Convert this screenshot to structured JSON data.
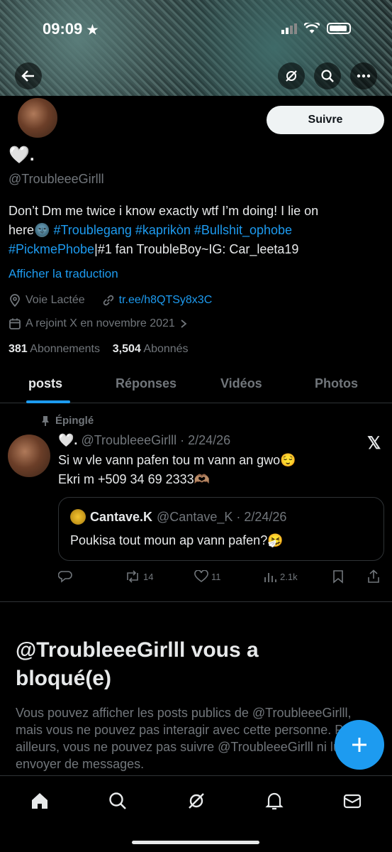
{
  "status_bar": {
    "time": "09:09"
  },
  "header": {
    "follow_label": "Suivre"
  },
  "profile": {
    "name": "🤍.",
    "handle": "@TroubleeeGirlll",
    "bio_line1": "Don’t Dm me twice i know exactly wtf I’m doing! I lie on",
    "bio_line2_text": "here🌚 ",
    "bio_hashtags_line2": "#Troublegang #kaprikòn #Bullshit_ophobe",
    "bio_hashtag_line3": "#PickmePhobe",
    "bio_line3_rest": "|#1 fan TroubleBoy~IG: Car_leeta19",
    "translate": "Afficher la traduction",
    "location": "Voie Lactée",
    "website": "tr.ee/h8QTSy8x3C",
    "joined": "A rejoint X en novembre 2021",
    "following_count": "381",
    "following_label": "Abonnements",
    "followers_count": "3,504",
    "followers_label": "Abonnés"
  },
  "tabs": [
    {
      "label": "posts",
      "active": true
    },
    {
      "label": "Réponses",
      "active": false
    },
    {
      "label": "Vidéos",
      "active": false
    },
    {
      "label": "Photos",
      "active": false
    }
  ],
  "pinned_tweet": {
    "pinned_label": "Épinglé",
    "author_name": "🤍.",
    "author_handle_date": "@TroubleeeGirlll · 2/24/26",
    "text_line1": "Si w vle vann pafen tou m vann an gwo😌",
    "text_line2": "Ekri m +509 34 69 2333🫶🏽",
    "quote": {
      "author_name": "Cantave.K",
      "author_handle_date": "@Cantave_K · 2/24/26",
      "text": "Poukisa tout moun ap vann pafen?🤧"
    },
    "retweets": "14",
    "likes": "11",
    "views": "2.1k"
  },
  "blocked": {
    "title": "@TroubleeeGirlll vous a bloqué(e)",
    "message": "Vous pouvez afficher les posts publics de @TroubleeeGirlll, mais vous ne pouvez pas interagir avec cette personne. Par ailleurs, vous ne pouvez pas suivre @TroubleeeGirlll ni lui envoyer de messages."
  },
  "colors": {
    "accent": "#1d9bf0",
    "background": "#000000",
    "muted_text": "#71767b",
    "primary_text": "#e7e9ea"
  }
}
